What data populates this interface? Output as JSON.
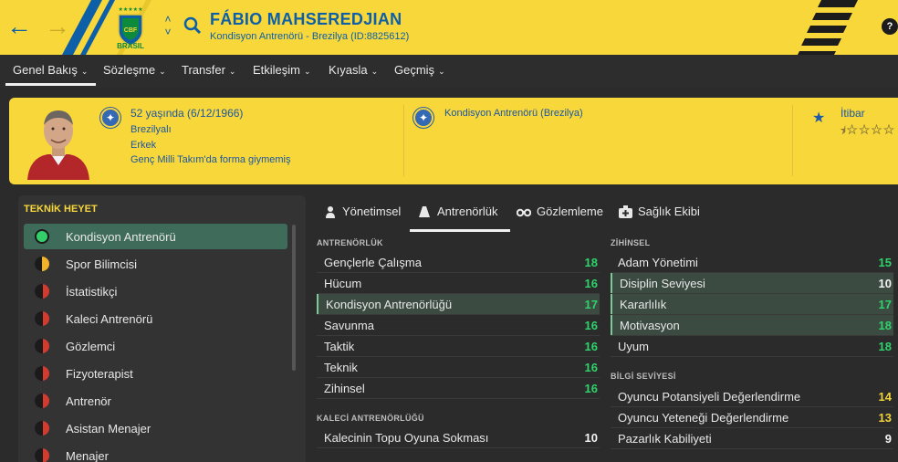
{
  "header": {
    "person_name": "FÁBIO MAHSEREDJIAN",
    "person_sub": "Kondisyon Antrenörü - Brezilya (ID:8825612)",
    "crest_label": "BRASIL"
  },
  "menu": [
    {
      "label": "Genel Bakış"
    },
    {
      "label": "Sözleşme"
    },
    {
      "label": "Transfer"
    },
    {
      "label": "Etkileşim"
    },
    {
      "label": "Kıyasla"
    },
    {
      "label": "Geçmiş"
    }
  ],
  "profile": {
    "age": "52 yaşında (6/12/1966)",
    "nationality": "Brezilyalı",
    "gender": "Erkek",
    "national_team": "Genç Milli Takım'da forma giymemiş",
    "role": "Kondisyon Antrenörü (Brezilya)",
    "reputation_label": "İtibar",
    "reputation_stars": 0.5
  },
  "sidebar": {
    "title": "TEKNİK HEYET",
    "items": [
      {
        "label": "Kondisyon Antrenörü",
        "color": "#33d06a"
      },
      {
        "label": "Spor Bilimcisi",
        "color": "#f0b32a"
      },
      {
        "label": "İstatistikçi",
        "color": "#d23b2e"
      },
      {
        "label": "Kaleci Antrenörü",
        "color": "#d23b2e"
      },
      {
        "label": "Gözlemci",
        "color": "#d23b2e"
      },
      {
        "label": "Fizyoterapist",
        "color": "#d23b2e"
      },
      {
        "label": "Antrenör",
        "color": "#d23b2e"
      },
      {
        "label": "Asistan Menajer",
        "color": "#d23b2e"
      },
      {
        "label": "Menajer",
        "color": "#d23b2e"
      }
    ]
  },
  "tabs": [
    {
      "label": "Yönetimsel",
      "icon": "person-icon"
    },
    {
      "label": "Antrenörlük",
      "icon": "cone-icon"
    },
    {
      "label": "Gözlemleme",
      "icon": "binoculars-icon"
    },
    {
      "label": "Sağlık Ekibi",
      "icon": "medkit-icon"
    }
  ],
  "coaching": {
    "title": "ANTRENÖRLÜK",
    "rows": [
      {
        "name": "Gençlerle Çalışma",
        "value": "18"
      },
      {
        "name": "Hücum",
        "value": "16"
      },
      {
        "name": "Kondisyon Antrenörlüğü",
        "value": "17"
      },
      {
        "name": "Savunma",
        "value": "16"
      },
      {
        "name": "Taktik",
        "value": "16"
      },
      {
        "name": "Teknik",
        "value": "16"
      },
      {
        "name": "Zihinsel",
        "value": "16"
      }
    ]
  },
  "gk_coaching": {
    "title": "KALECİ ANTRENÖRLÜĞÜ",
    "rows": [
      {
        "name": "Kalecinin Topu Oyuna Sokması",
        "value": "10"
      }
    ]
  },
  "mental": {
    "title": "ZİHİNSEL",
    "rows": [
      {
        "name": "Adam Yönetimi",
        "value": "15"
      },
      {
        "name": "Disiplin Seviyesi",
        "value": "10"
      },
      {
        "name": "Kararlılık",
        "value": "17"
      },
      {
        "name": "Motivasyon",
        "value": "18"
      },
      {
        "name": "Uyum",
        "value": "18"
      }
    ]
  },
  "knowledge": {
    "title": "BİLGİ SEVİYESİ",
    "rows": [
      {
        "name": "Oyuncu Potansiyeli Değerlendirme",
        "value": "14"
      },
      {
        "name": "Oyuncu Yeteneği Değerlendirme",
        "value": "13"
      },
      {
        "name": "Pazarlık Kabiliyeti",
        "value": "9"
      }
    ]
  }
}
